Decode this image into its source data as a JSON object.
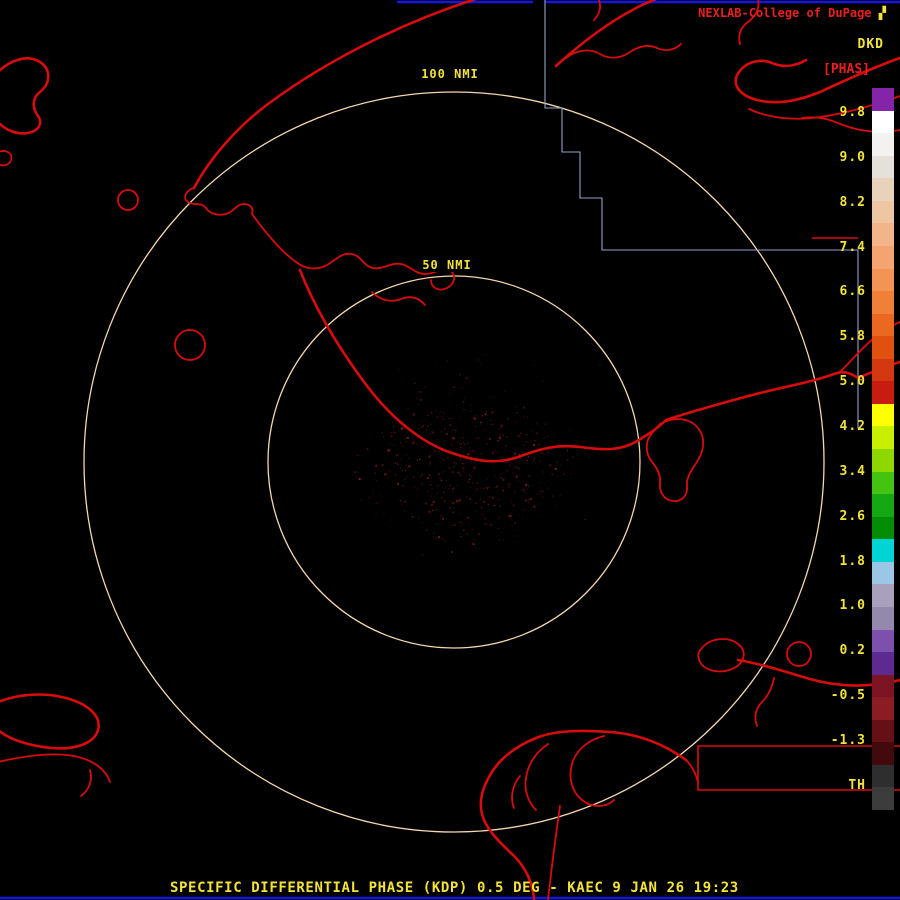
{
  "header": {
    "brand": "NEXLAB-College of DuPage",
    "logo_glyph": "▞",
    "product_code": "DKD",
    "units_label": "[PHAS]"
  },
  "range_rings": {
    "outer_label": "100 NMI",
    "inner_label": "50 NMI"
  },
  "colorbar": {
    "tick_labels": [
      "9.8",
      "9.0",
      "8.2",
      "7.4",
      "6.6",
      "5.8",
      "5.0",
      "4.2",
      "3.4",
      "2.6",
      "1.8",
      "1.0",
      "0.2",
      "-0.5",
      "-1.3",
      "TH"
    ],
    "stops": [
      "#8424a8",
      "#ffffff",
      "#f4f2f0",
      "#e6e0da",
      "#e8d2bc",
      "#eec6a2",
      "#f2b488",
      "#f4a470",
      "#f49454",
      "#f08038",
      "#ea6820",
      "#e0500e",
      "#d43810",
      "#c81c10",
      "#ffff00",
      "#c8ee00",
      "#8cd800",
      "#44c410",
      "#14a814",
      "#048c04",
      "#00d4d4",
      "#9cc6e6",
      "#a8a0bc",
      "#9488ac",
      "#7c50ac",
      "#5c2a90",
      "#7c1424",
      "#8c1c24",
      "#641014",
      "#420a0c",
      "#2e2e2e",
      "#3c3c3c"
    ]
  },
  "footer": {
    "caption": "SPECIFIC DIFFERENTIAL PHASE (KDP) 0.5 DEG - KAEC 9 JAN 26 19:23"
  },
  "colors": {
    "map": "#d80c0c",
    "ring": "#f4d7ae",
    "yellow": "#f2e23a",
    "red": "#e82020",
    "blue": "#1616e0",
    "boundary": "#93a2c8",
    "echo1": "#6e1012",
    "echo2": "#8c1a1a",
    "echo3": "#a82828"
  }
}
